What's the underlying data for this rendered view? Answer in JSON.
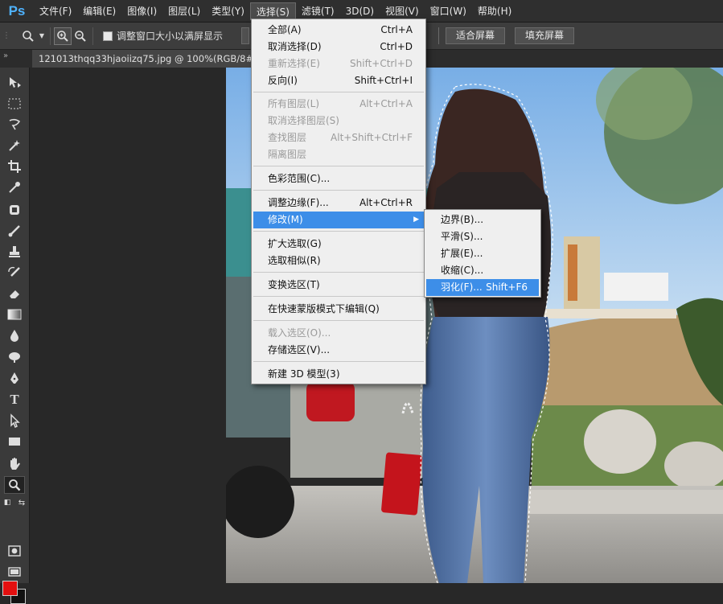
{
  "app": {
    "logo": "Ps"
  },
  "menubar": {
    "items": [
      "文件(F)",
      "编辑(E)",
      "图像(I)",
      "图层(L)",
      "类型(Y)",
      "选择(S)",
      "滤镜(T)",
      "3D(D)",
      "视图(V)",
      "窗口(W)",
      "帮助(H)"
    ],
    "active_index": 5
  },
  "options": {
    "fit_window_label": "调整窗口大小以满屏显示",
    "fit_screen_button": "适合屏幕",
    "fill_screen_button": "填充屏幕"
  },
  "document": {
    "tab_title": "121013thqq33hjaoiizq75.jpg @ 100%(RGB/8#) *"
  },
  "select_menu": {
    "items": [
      {
        "label": "全部(A)",
        "shortcut": "Ctrl+A",
        "disabled": false
      },
      {
        "label": "取消选择(D)",
        "shortcut": "Ctrl+D",
        "disabled": false
      },
      {
        "label": "重新选择(E)",
        "shortcut": "Shift+Ctrl+D",
        "disabled": true
      },
      {
        "label": "反向(I)",
        "shortcut": "Shift+Ctrl+I",
        "disabled": false
      },
      {
        "label": "所有图层(L)",
        "shortcut": "Alt+Ctrl+A",
        "disabled": true
      },
      {
        "label": "取消选择图层(S)",
        "shortcut": "",
        "disabled": true
      },
      {
        "label": "查找图层",
        "shortcut": "Alt+Shift+Ctrl+F",
        "disabled": true
      },
      {
        "label": "隔离图层",
        "shortcut": "",
        "disabled": true
      },
      {
        "label": "色彩范围(C)...",
        "shortcut": "",
        "disabled": false
      },
      {
        "label": "调整边缘(F)...",
        "shortcut": "Alt+Ctrl+R",
        "disabled": false
      },
      {
        "label": "修改(M)",
        "shortcut": "",
        "disabled": false
      },
      {
        "label": "扩大选取(G)",
        "shortcut": "",
        "disabled": false
      },
      {
        "label": "选取相似(R)",
        "shortcut": "",
        "disabled": false
      },
      {
        "label": "变换选区(T)",
        "shortcut": "",
        "disabled": false
      },
      {
        "label": "在快速蒙版模式下编辑(Q)",
        "shortcut": "",
        "disabled": false
      },
      {
        "label": "载入选区(O)...",
        "shortcut": "",
        "disabled": true
      },
      {
        "label": "存储选区(V)...",
        "shortcut": "",
        "disabled": false
      },
      {
        "label": "新建 3D 模型(3)",
        "shortcut": "",
        "disabled": false
      }
    ]
  },
  "modify_submenu": {
    "items": [
      {
        "label": "边界(B)...",
        "shortcut": ""
      },
      {
        "label": "平滑(S)...",
        "shortcut": ""
      },
      {
        "label": "扩展(E)...",
        "shortcut": ""
      },
      {
        "label": "收缩(C)...",
        "shortcut": ""
      },
      {
        "label": "羽化(F)...",
        "shortcut": "Shift+F6"
      }
    ]
  },
  "colors": {
    "foreground": "#e31010",
    "background": "#111111",
    "menu_highlight": "#3d8ee8"
  },
  "tools": [
    "move-icon",
    "rect-marquee-icon",
    "lasso-icon",
    "magic-wand-icon",
    "crop-icon",
    "eyedropper-icon",
    "healing-icon",
    "brush-icon",
    "stamp-icon",
    "history-brush-icon",
    "eraser-icon",
    "gradient-icon",
    "blur-icon",
    "dodge-icon",
    "pen-icon",
    "type-icon",
    "path-select-icon",
    "shape-icon",
    "hand-icon",
    "zoom-icon"
  ]
}
